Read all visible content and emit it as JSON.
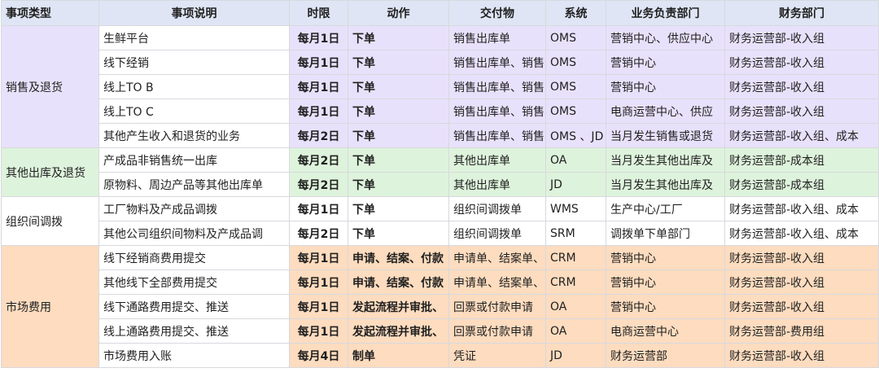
{
  "headers": [
    "事项类型",
    "事项说明",
    "时限",
    "动作",
    "交付物",
    "系统",
    "业务负责部门",
    "财务部门"
  ],
  "groups": [
    {
      "category": "销售及退货",
      "color": "purple",
      "rows": [
        [
          "生鲜平台",
          "每月1日",
          "下单",
          "销售出库单",
          "OMS",
          "营销中心、供应中心",
          "财务运营部-收入组"
        ],
        [
          "线下经销",
          "每月1日",
          "下单",
          "销售出库单、销售",
          "OMS",
          "营销中心",
          "财务运营部-收入组"
        ],
        [
          "线上TO B",
          "每月1日",
          "下单",
          "销售出库单、销售",
          "OMS",
          "营销中心",
          "财务运营部-收入组"
        ],
        [
          "线上TO C",
          "每月1日",
          "下单",
          "销售出库单、销售",
          "OMS",
          "电商运营中心、供应",
          "财务运营部-收入组"
        ],
        [
          "其他产生收入和退货的业务",
          "每月2日",
          "下单",
          "销售出库单、销售",
          "OMS 、JD",
          "当月发生销售或退货",
          "财务运营部-收入组、成本"
        ]
      ]
    },
    {
      "category": "其他出库及退货",
      "color": "green",
      "rows": [
        [
          "产成品非销售统一出库",
          "每月2日",
          "下单",
          "其他出库单",
          "OA",
          "当月发生其他出库及",
          "财务运营部-成本组"
        ],
        [
          "原物料、周边产品等其他出库单",
          "每月2日",
          "下单",
          "其他出库单",
          "JD",
          "当月发生其他出库及",
          "财务运营部-成本组"
        ]
      ]
    },
    {
      "category": "组织间调拨",
      "color": "white",
      "rows": [
        [
          "工厂物料及产成品调拨",
          "每月1日",
          "下单",
          "组织间调拨单",
          "WMS",
          "生产中心/工厂",
          "财务运营部-收入组、成本"
        ],
        [
          "其他公司组织间物料及产成品调",
          "每月2日",
          "下单",
          "组织间调拨单",
          "SRM",
          "调拨单下单部门",
          "财务运营部-收入组、成本"
        ]
      ]
    },
    {
      "category": "市场费用",
      "color": "orange",
      "rows": [
        [
          "线下经销商费用提交",
          "每月1日",
          "申请、结案、付款",
          "申请单、结案单、",
          "CRM",
          "营销中心",
          "财务运营部-收入组"
        ],
        [
          "其他线下全部费用提交",
          "每月1日",
          "申请、结案、付款",
          "申请单、结案单、",
          "CRM",
          "营销中心",
          "财务运营部-收入组"
        ],
        [
          "线下通路费用提交、推送",
          "每月1日",
          "发起流程并审批、",
          "回票或付款申请",
          "OA",
          "营销中心",
          "财务运营部-收入组"
        ],
        [
          "线上通路费用提交、推送",
          "每月1日",
          "发起流程并审批、",
          "回票或付款申请",
          "OA",
          "电商运营中心",
          "财务运营部-费用组"
        ],
        [
          "市场费用入账",
          "每月4日",
          "制单",
          "凭证",
          "JD",
          "财务运营部",
          "财务运营部-收入组"
        ]
      ]
    }
  ]
}
